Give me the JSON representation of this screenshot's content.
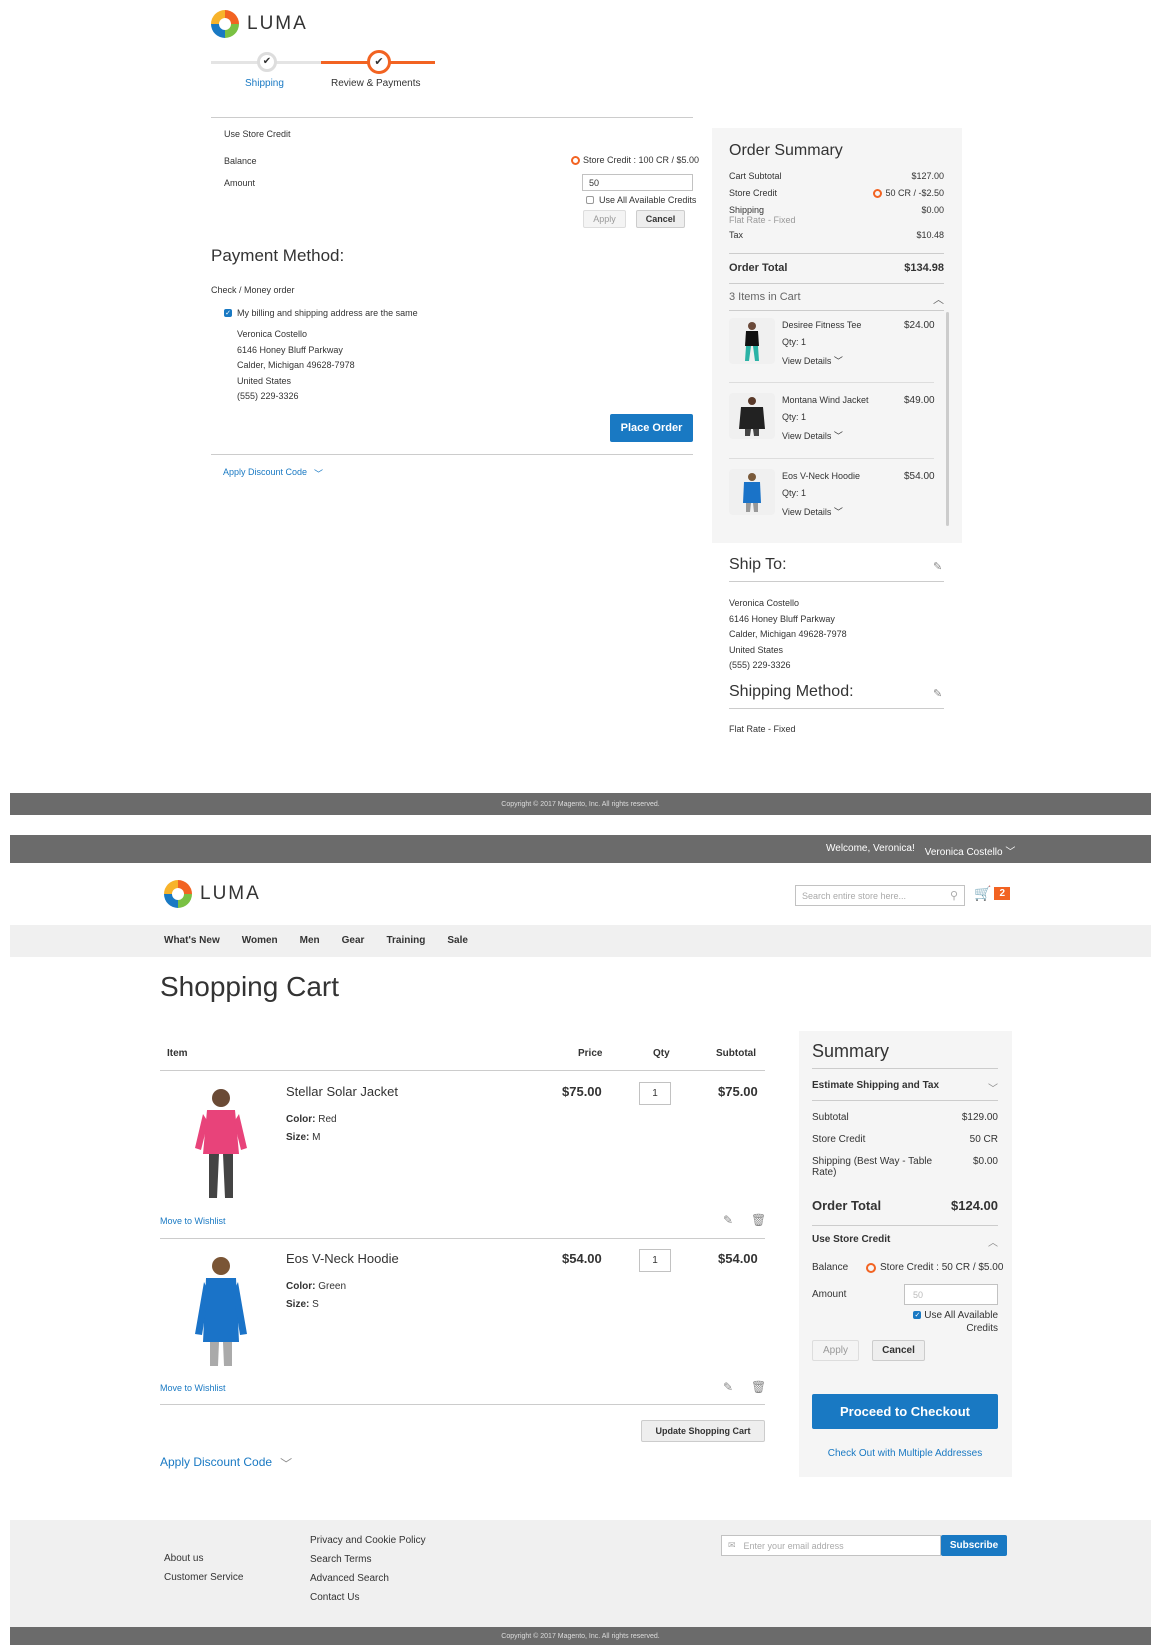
{
  "checkout": {
    "logo": "LUMA",
    "steps": [
      {
        "label": "Shipping"
      },
      {
        "label": "Review & Payments"
      }
    ],
    "store_credit": {
      "title": "Use Store Credit",
      "balance_label": "Balance",
      "balance_value": "Store Credit : 100 CR / $5.00",
      "amount_label": "Amount",
      "amount_value": "50",
      "use_all_label": "Use All Available Credits",
      "apply": "Apply",
      "cancel": "Cancel"
    },
    "payment_title": "Payment Method:",
    "payment_method": "Check / Money order",
    "same_address_label": "My billing and shipping address are the same",
    "address": [
      "Veronica Costello",
      "6146 Honey Bluff Parkway",
      "Calder, Michigan 49628-7978",
      "United States",
      "(555) 229-3326"
    ],
    "place_order": "Place Order",
    "discount": "Apply Discount Code",
    "summary": {
      "title": "Order Summary",
      "rows": [
        {
          "label": "Cart Subtotal",
          "value": "$127.00"
        },
        {
          "label": "Store Credit",
          "value": "50 CR / -$2.50"
        },
        {
          "label": "Shipping",
          "sub": "Flat Rate - Fixed",
          "value": "$0.00"
        },
        {
          "label": "Tax",
          "value": "$10.48"
        }
      ],
      "total_label": "Order Total",
      "total_value": "$134.98",
      "items_title": "3 Items in Cart",
      "items": [
        {
          "name": "Desiree Fitness Tee",
          "price": "$24.00",
          "qty": "Qty: 1",
          "details": "View Details"
        },
        {
          "name": "Montana Wind Jacket",
          "price": "$49.00",
          "qty": "Qty: 1",
          "details": "View Details"
        },
        {
          "name": "Eos V-Neck Hoodie",
          "price": "$54.00",
          "qty": "Qty: 1",
          "details": "View Details"
        }
      ]
    },
    "ship_to_title": "Ship To:",
    "ship_to": [
      "Veronica Costello",
      "6146 Honey Bluff Parkway",
      "Calder, Michigan 49628-7978",
      "United States",
      "(555) 229-3326"
    ],
    "shipping_method_title": "Shipping Method:",
    "shipping_method": "Flat Rate - Fixed",
    "copyright": "Copyright © 2017 Magento, Inc. All rights reserved."
  },
  "cart": {
    "welcome": "Welcome, Veronica!",
    "user": "Veronica Costello",
    "logo": "LUMA",
    "search_placeholder": "Search entire store here...",
    "cart_count": "2",
    "nav": [
      "What's New",
      "Women",
      "Men",
      "Gear",
      "Training",
      "Sale"
    ],
    "title": "Shopping Cart",
    "headers": {
      "item": "Item",
      "price": "Price",
      "qty": "Qty",
      "subtotal": "Subtotal"
    },
    "items": [
      {
        "name": "Stellar Solar Jacket",
        "price": "$75.00",
        "qty": "1",
        "subtotal": "$75.00",
        "color_label": "Color:",
        "color": "Red",
        "size_label": "Size:",
        "size": "M",
        "wishlist": "Move to Wishlist"
      },
      {
        "name": "Eos V-Neck Hoodie",
        "price": "$54.00",
        "qty": "1",
        "subtotal": "$54.00",
        "color_label": "Color:",
        "color": "Green",
        "size_label": "Size:",
        "size": "S",
        "wishlist": "Move to Wishlist"
      }
    ],
    "update": "Update Shopping Cart",
    "discount": "Apply Discount Code",
    "summary": {
      "title": "Summary",
      "estimate": "Estimate Shipping and Tax",
      "rows": [
        {
          "label": "Subtotal",
          "value": "$129.00"
        },
        {
          "label": "Store Credit",
          "value": "50 CR"
        },
        {
          "label": "Shipping (Best Way - Table Rate)",
          "value": "$0.00"
        }
      ],
      "total_label": "Order Total",
      "total_value": "$124.00",
      "store_credit_title": "Use Store Credit",
      "balance_label": "Balance",
      "balance_value": "Store Credit : 50 CR / $5.00",
      "amount_label": "Amount",
      "amount_placeholder": "50",
      "use_all_label": "Use All Available Credits",
      "apply": "Apply",
      "cancel": "Cancel",
      "checkout": "Proceed to Checkout",
      "multi": "Check Out with Multiple Addresses"
    },
    "footer": {
      "col1": [
        "About us",
        "Customer Service"
      ],
      "col2": [
        "Privacy and Cookie Policy",
        "Search Terms",
        "Advanced Search",
        "Contact Us"
      ],
      "email_placeholder": "Enter your email address",
      "subscribe": "Subscribe"
    },
    "copyright": "Copyright © 2017 Magento, Inc. All rights reserved."
  },
  "colors": {
    "accent": "#1979c3",
    "orange": "#f26322"
  }
}
